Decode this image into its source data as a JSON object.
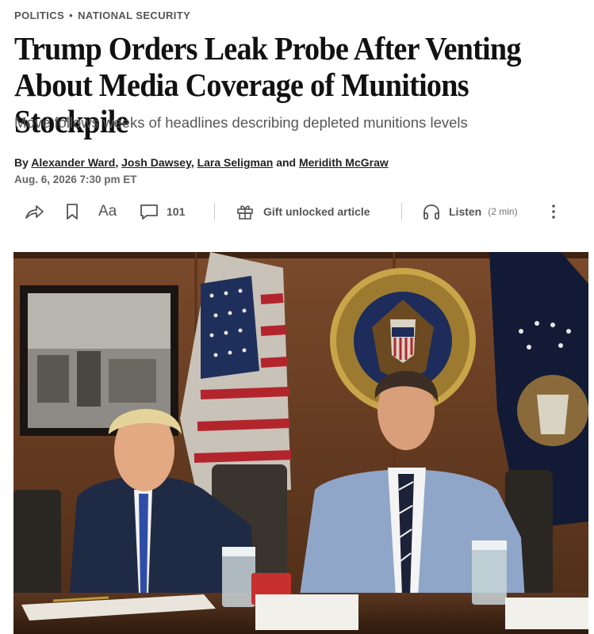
{
  "kicker": {
    "section": "POLITICS",
    "subsection": "NATIONAL SECURITY",
    "separator": "•"
  },
  "headline": "Trump Orders Leak Probe After Venting About Media Coverage of Munitions Stockpile",
  "dek": "Move follows weeks of headlines describing depleted munitions levels",
  "byline": {
    "prefix": "By",
    "authors": [
      "Alexander Ward",
      "Josh Dawsey",
      "Lara Seligman",
      "Meridith McGraw"
    ],
    "sep1": ",",
    "sep2": ",",
    "and": "and"
  },
  "date": "Aug. 6, 2026 7:30 pm ET",
  "toolbar": {
    "font_label": "Aa",
    "comments_count": "101",
    "gift_label": "Gift unlocked article",
    "listen_label": "Listen",
    "listen_duration": "(2 min)",
    "icons": [
      "share-icon",
      "bookmark-icon",
      "font-size-icon",
      "comment-icon",
      "gift-icon",
      "headphones-icon",
      "more-icon"
    ]
  },
  "photo": {
    "seal_text": "PRESIDENT OF THE UNITED STATES",
    "colors": {
      "wall": "#6b3f23",
      "suit_left": "#1f2a44",
      "suit_right": "#8fa6c9",
      "table": "#4a2c1a"
    }
  }
}
